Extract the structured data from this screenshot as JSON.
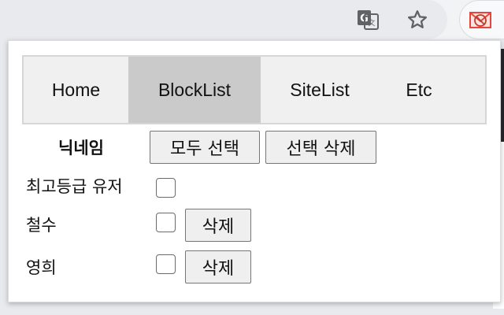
{
  "toolbar": {
    "icons": [
      "translate-icon",
      "star-icon",
      "extension-block-icon"
    ],
    "star_glyph": "☆"
  },
  "nav": {
    "items": [
      {
        "label": "Home"
      },
      {
        "label": "BlockList",
        "active": true
      },
      {
        "label": "SiteList"
      },
      {
        "label": "Etc"
      }
    ]
  },
  "list": {
    "header": "닉네임",
    "select_all_label": "모두 선택",
    "delete_selected_label": "선택 삭제",
    "top_user": {
      "label": "최고등급 유저",
      "checked": false
    },
    "rows": [
      {
        "name": "철수",
        "checked": false,
        "delete_label": "삭제"
      },
      {
        "name": "영희",
        "checked": false,
        "delete_label": "삭제"
      }
    ]
  },
  "colors": {
    "active_tab": "#cacaca",
    "nav_bg": "#f0f0f0",
    "ext_icon_red": "#e8453c"
  }
}
